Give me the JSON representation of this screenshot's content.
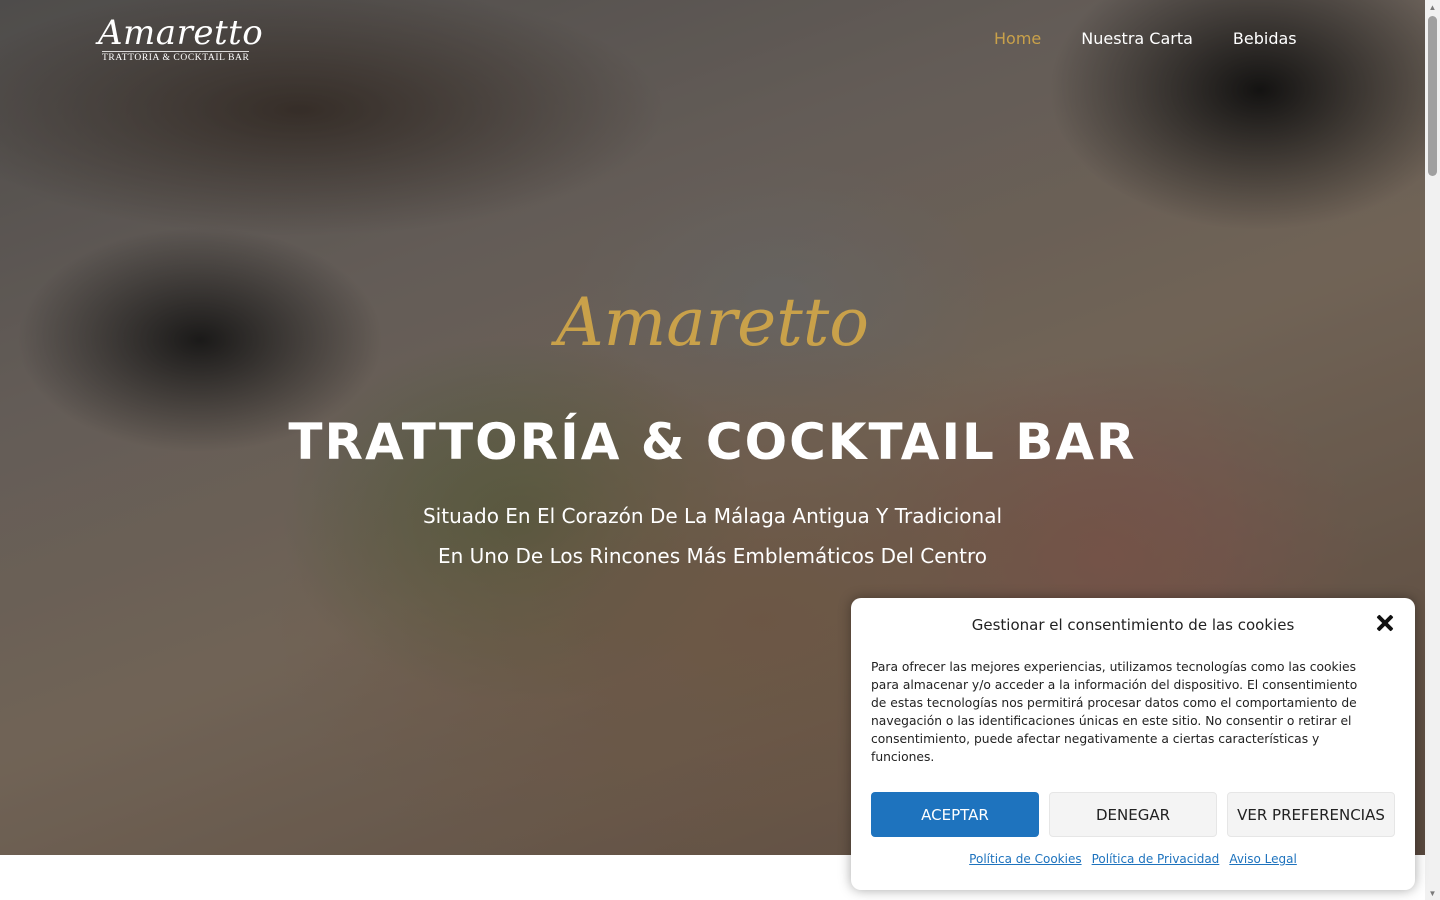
{
  "header": {
    "logo_script": "Amaretto",
    "logo_tagline": "TRATTORIA & COCKTAIL BAR",
    "nav": [
      {
        "label": "Home",
        "active": true
      },
      {
        "label": "Nuestra Carta",
        "active": false
      },
      {
        "label": "Bebidas",
        "active": false
      }
    ]
  },
  "hero": {
    "script": "Amaretto",
    "title": "TRATTORÍA & COCKTAIL BAR",
    "subtitle_1": "Situado En El Corazón De La Málaga Antigua Y Tradicional",
    "subtitle_2": "En Uno De Los Rincones Más Emblemáticos Del Centro"
  },
  "cookie_banner": {
    "title": "Gestionar el consentimiento de las cookies",
    "text": "Para ofrecer las mejores experiencias, utilizamos tecnologías como las cookies para almacenar y/o acceder a la información del dispositivo. El consentimiento de estas tecnologías nos permitirá procesar datos como el comportamiento de navegación o las identificaciones únicas en este sitio. No consentir o retirar el consentimiento, puede afectar negativamente a ciertas características y funciones.",
    "accept_label": "ACEPTAR",
    "deny_label": "DENEGAR",
    "prefs_label": "VER PREFERENCIAS",
    "links": [
      "Política de Cookies",
      "Política de Privacidad",
      "Aviso Legal"
    ]
  },
  "icons": {
    "close": "close-icon",
    "scroll_up": "chevron-up-icon",
    "scroll_down": "chevron-down-icon"
  },
  "colors": {
    "accent_gold": "#c9a14a",
    "button_blue": "#1e73be"
  }
}
